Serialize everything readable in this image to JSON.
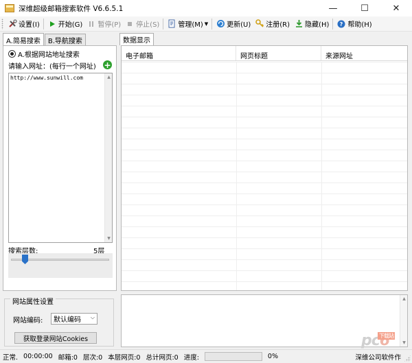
{
  "window": {
    "title": "深维超级邮箱搜索软件 V6.6.5.1",
    "minimize": "—",
    "maximize": "☐",
    "close": "✕"
  },
  "toolbar": {
    "settings": {
      "label": "设置(I)",
      "icon": "tools-icon"
    },
    "start": {
      "label": "开始(G)",
      "icon": "play-icon"
    },
    "pause": {
      "label": "暂停(P)",
      "icon": "pause-icon"
    },
    "stop": {
      "label": "停止(S)",
      "icon": "stop-icon"
    },
    "manage": {
      "label": "管理(M)",
      "icon": "document-icon"
    },
    "update": {
      "label": "更新(U)",
      "icon": "refresh-icon"
    },
    "register": {
      "label": "注册(R)",
      "icon": "key-icon"
    },
    "hide": {
      "label": "隐藏(H)",
      "icon": "download-icon"
    },
    "help": {
      "label": "帮助(H)",
      "icon": "help-icon"
    }
  },
  "left_tabs": [
    {
      "label": "A.简易搜索",
      "active": true
    },
    {
      "label": "B.导航搜索",
      "active": false
    }
  ],
  "simple_search": {
    "radio_label": "A.根据网站地址搜索",
    "url_prompt": "请输入网址：(每行一个网址)",
    "url_value": "http://www.sunwill.com",
    "depth_label": "搜索层数:",
    "depth_value": "5层",
    "depth_slider_position": 0.12
  },
  "site_props": {
    "title": "网站属性设置",
    "encoding_label": "网站编码:",
    "encoding_value": "默认编码",
    "cookies_button": "获取登录网站Cookies"
  },
  "data_panel": {
    "tab_label": "数据显示",
    "columns": [
      "电子邮箱",
      "网页标题",
      "来源网址"
    ],
    "rows": []
  },
  "statusbar": {
    "state": "正常.",
    "elapsed": "00:00:00",
    "emails": "邮箱:0",
    "level": "层次:0",
    "page_level": "本层网页:0",
    "total_pages": "总计网页:0",
    "progress_label": "进度:",
    "progress_value": 0,
    "progress_text": "0%",
    "company": "深维公司软件作"
  },
  "watermark": {
    "text": "pc6",
    "sub": "下载站"
  },
  "colors": {
    "toolbar_bg": "#f5f5f5",
    "slider_thumb": "#2a72c8",
    "add_button": "#2ea02e"
  }
}
